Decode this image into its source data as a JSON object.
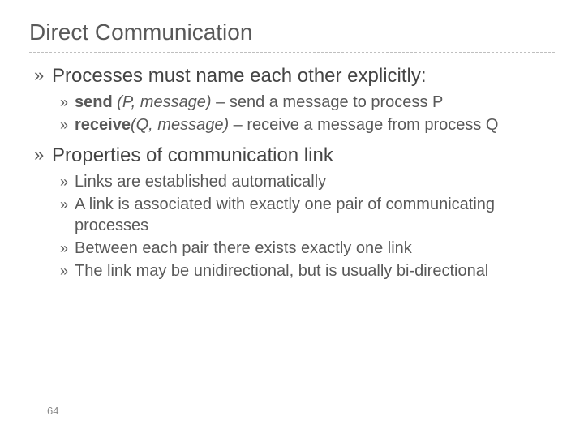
{
  "title": "Direct Communication",
  "bullet_glyph": "»",
  "sections": [
    {
      "text": "Processes must name each other explicitly:",
      "children": [
        {
          "bold": "send",
          "italic": " (P, message)",
          "rest": " – send a message to process P"
        },
        {
          "bold": "receive",
          "italic": "(Q, message)",
          "rest": " – receive a message from process Q"
        }
      ]
    },
    {
      "text": "Properties of communication link",
      "children": [
        {
          "rest": "Links are established automatically"
        },
        {
          "rest": "A link is associated with exactly one pair of communicating processes"
        },
        {
          "rest": "Between each pair there exists exactly one link"
        },
        {
          "rest": "The link may be unidirectional, but is usually bi-directional"
        }
      ]
    }
  ],
  "page_number": "64"
}
